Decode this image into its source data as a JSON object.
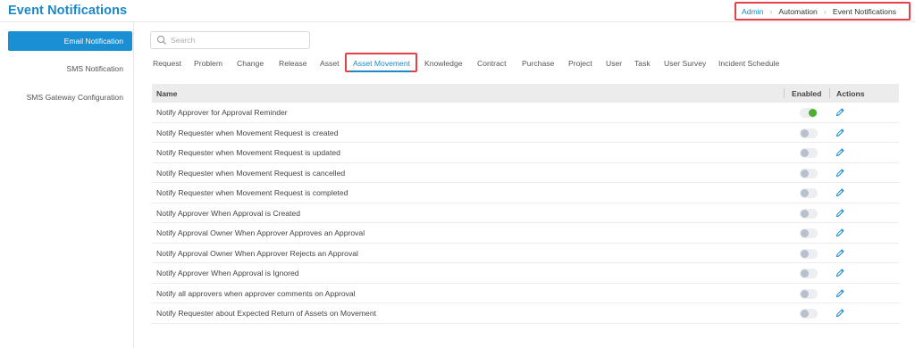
{
  "header": {
    "title": "Event Notifications"
  },
  "breadcrumb": [
    {
      "label": "Admin"
    },
    {
      "label": "Automation"
    },
    {
      "label": "Event Notifications"
    }
  ],
  "sidebar": {
    "items": [
      {
        "label": "Email Notification",
        "active": true
      },
      {
        "label": "SMS Notification"
      },
      {
        "label": "SMS Gateway Configuration"
      }
    ]
  },
  "search": {
    "placeholder": "Search",
    "value": ""
  },
  "tabs": [
    {
      "label": "Request"
    },
    {
      "label": "Problem"
    },
    {
      "label": "Change"
    },
    {
      "label": "Release"
    },
    {
      "label": "Asset"
    },
    {
      "label": "Asset Movement",
      "active": true
    },
    {
      "label": "Knowledge"
    },
    {
      "label": "Contract"
    },
    {
      "label": "Purchase"
    },
    {
      "label": "Project"
    },
    {
      "label": "User"
    },
    {
      "label": "Task"
    },
    {
      "label": "User Survey"
    },
    {
      "label": "Incident Schedule"
    }
  ],
  "table": {
    "columns": {
      "name": "Name",
      "enabled": "Enabled",
      "actions": "Actions"
    },
    "rows": [
      {
        "name": "Notify Approver for Approval Reminder",
        "enabled": true
      },
      {
        "name": "Notify Requester when Movement Request is created",
        "enabled": false
      },
      {
        "name": "Notify Requester when Movement Request is updated",
        "enabled": false
      },
      {
        "name": "Notify Requester when Movement Request is cancelled",
        "enabled": false
      },
      {
        "name": "Notify Requester when Movement Request is completed",
        "enabled": false
      },
      {
        "name": "Notify Approver When Approval is Created",
        "enabled": false
      },
      {
        "name": "Notify Approval Owner When Approver Approves an Approval",
        "enabled": false
      },
      {
        "name": "Notify Approval Owner When Approver Rejects an Approval",
        "enabled": false
      },
      {
        "name": "Notify Approver When Approval is Ignored",
        "enabled": false
      },
      {
        "name": "Notify all approvers when approver comments on Approval",
        "enabled": false
      },
      {
        "name": "Notify Requester about Expected Return of Assets on Movement",
        "enabled": false
      }
    ]
  },
  "icons": {
    "search": "search-icon",
    "edit": "pencil-icon",
    "separator": "chevron-right-icon"
  },
  "colors": {
    "accent": "#1a88c9",
    "active_bg": "#1a8fd3",
    "highlight": "#e5404a",
    "toggle_on": "#4caf2e"
  }
}
